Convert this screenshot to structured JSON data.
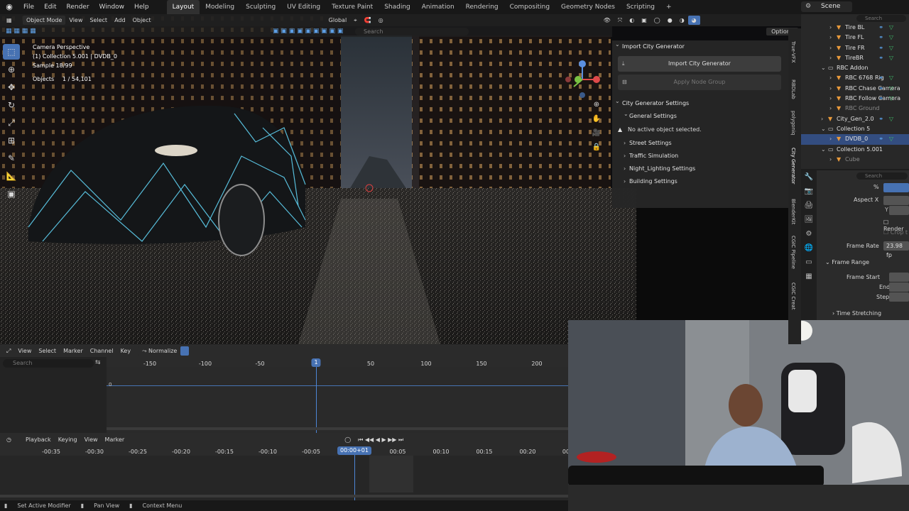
{
  "topbar": {
    "menus": [
      "File",
      "Edit",
      "Render",
      "Window",
      "Help"
    ],
    "workspaces": [
      "Layout",
      "Modeling",
      "Sculpting",
      "UV Editing",
      "Texture Paint",
      "Shading",
      "Animation",
      "Rendering",
      "Compositing",
      "Geometry Nodes",
      "Scripting"
    ],
    "active_workspace": "Layout",
    "add_tab": "+",
    "scene": "Scene"
  },
  "viewport": {
    "mode": "Object Mode",
    "menus": [
      "View",
      "Select",
      "Add",
      "Object"
    ],
    "transform_orientation": "Global",
    "search_placeholder": "Search",
    "options": "Options",
    "overlay": {
      "line1": "Camera Perspective",
      "line2": "(1) Collection 5.001 | DVDB_0",
      "line3": "Sample 18/99",
      "objects_label": "Objects",
      "objects_value": "1 / 54,101"
    }
  },
  "npanel": {
    "import_header": "Import City Generator",
    "import_button": "Import City Generator",
    "apply_button": "Apply Node Group",
    "settings_header": "City Generator Settings",
    "general": "General Settings",
    "warning": "No active object selected.",
    "sections": [
      "Street Settings",
      "Traffic Simulation",
      "Night_Lighting Settings",
      "Building Settings"
    ],
    "vertical_tabs": [
      "True-VFX",
      "RBDLab",
      "polygoniq",
      "City Generator",
      "BlenderKit",
      "CGIC Pipeline",
      "CGIC Creat"
    ]
  },
  "outliner": {
    "rows": [
      {
        "label": "Tire BL",
        "indent": 2,
        "type": "object"
      },
      {
        "label": "Tire FL",
        "indent": 2,
        "type": "object"
      },
      {
        "label": "Tire FR",
        "indent": 2,
        "type": "object"
      },
      {
        "label": "TireBR",
        "indent": 2,
        "type": "object"
      },
      {
        "label": "RBC Addon",
        "indent": 1,
        "type": "collection"
      },
      {
        "label": "RBC 6768 Rig",
        "indent": 2,
        "type": "object"
      },
      {
        "label": "RBC Chase Camera",
        "indent": 2,
        "type": "object"
      },
      {
        "label": "RBC Follow Camera",
        "indent": 2,
        "type": "object"
      },
      {
        "label": "RBC Ground",
        "indent": 2,
        "type": "object",
        "dim": true
      },
      {
        "label": "City_Gen_2.0",
        "indent": 1,
        "type": "object"
      },
      {
        "label": "Collection 5",
        "indent": 1,
        "type": "collection"
      },
      {
        "label": "DVDB_0",
        "indent": 2,
        "type": "object",
        "selected": true
      },
      {
        "label": "Collection 5.001",
        "indent": 1,
        "type": "collection"
      },
      {
        "label": "Cube",
        "indent": 2,
        "type": "object",
        "dim": true
      }
    ]
  },
  "properties": {
    "search_placeholder": "Search",
    "percent": "%",
    "aspect_x": "Aspect X",
    "aspect_y": "Y",
    "render_region": "Render",
    "crop": "Crop t",
    "frame_rate_label": "Frame Rate",
    "frame_rate_value": "23.98 fp",
    "frame_range": "Frame Range",
    "frame_start": "Frame Start",
    "frame_end": "End",
    "frame_step": "Step",
    "time_stretching": "Time Stretching"
  },
  "graph": {
    "menus": [
      "View",
      "Select",
      "Marker",
      "Channel",
      "Key"
    ],
    "normalize": "Normalize",
    "search_placeholder": "Search",
    "ruler": [
      "-150",
      "-100",
      "-50",
      "1",
      "50",
      "100",
      "150",
      "200"
    ],
    "zero_label": "0",
    "current_frame": "1"
  },
  "timeline": {
    "menus": [
      "Playback",
      "Keying",
      "View",
      "Marker"
    ],
    "ruler": [
      "-00:35",
      "-00:30",
      "-00:25",
      "-00:20",
      "-00:15",
      "-00:10",
      "-00:05",
      "00:05",
      "00:10",
      "00:15",
      "00:20",
      "00"
    ],
    "current_time": "00:00+01"
  },
  "statusbar": {
    "items": [
      "Set Active Modifier",
      "Pan View",
      "Context Menu"
    ]
  },
  "colors": {
    "accent": "#4772b3",
    "selected_row": "#334d80",
    "panel": "#262626",
    "header": "#2b2b2b",
    "wire": "#5fd0f0"
  }
}
